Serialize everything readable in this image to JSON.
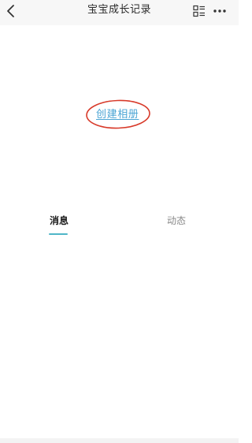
{
  "nav": {
    "title": "宝宝成长记录"
  },
  "album": {
    "create_label": "创建相册"
  },
  "tabs": [
    {
      "label": "消息",
      "active": true
    },
    {
      "label": "动态",
      "active": false
    }
  ],
  "colors": {
    "link": "#4aa4d4",
    "tab_indicator": "#4fb6c8",
    "annotation": "#d83a2a"
  }
}
